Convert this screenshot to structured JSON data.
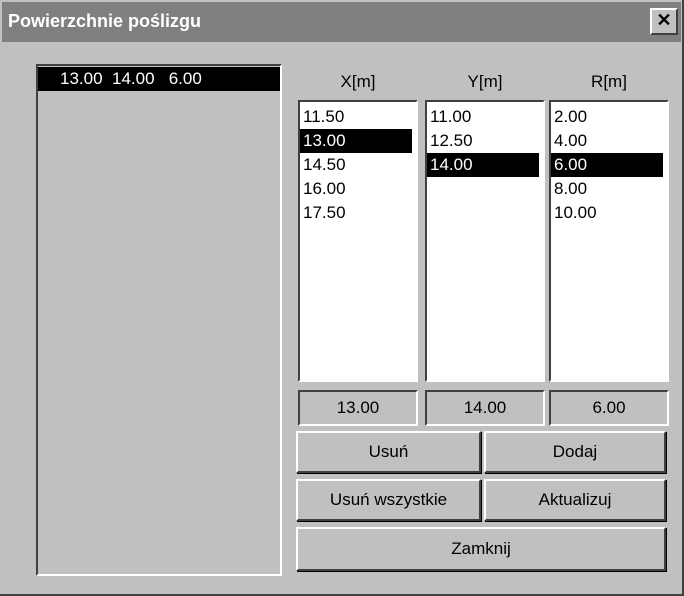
{
  "window": {
    "title": "Powierzchnie poślizgu",
    "close_label": "✕"
  },
  "surfaces_list": {
    "items": [
      "13.00  14.00   6.00"
    ],
    "selected_index": 0
  },
  "columns": {
    "x": {
      "label": "X[m]",
      "items": [
        "11.50",
        "13.00",
        "14.50",
        "16.00",
        "17.50"
      ],
      "selected_index": 1,
      "value": "13.00"
    },
    "y": {
      "label": "Y[m]",
      "items": [
        "11.00",
        "12.50",
        "14.00"
      ],
      "selected_index": 2,
      "value": "14.00"
    },
    "r": {
      "label": "R[m]",
      "items": [
        "2.00",
        "4.00",
        "6.00",
        "8.00",
        "10.00"
      ],
      "selected_index": 2,
      "value": "6.00"
    }
  },
  "buttons": {
    "remove": "Usuń",
    "add": "Dodaj",
    "remove_all": "Usuń wszystkie",
    "update": "Aktualizuj",
    "close": "Zamknij"
  }
}
